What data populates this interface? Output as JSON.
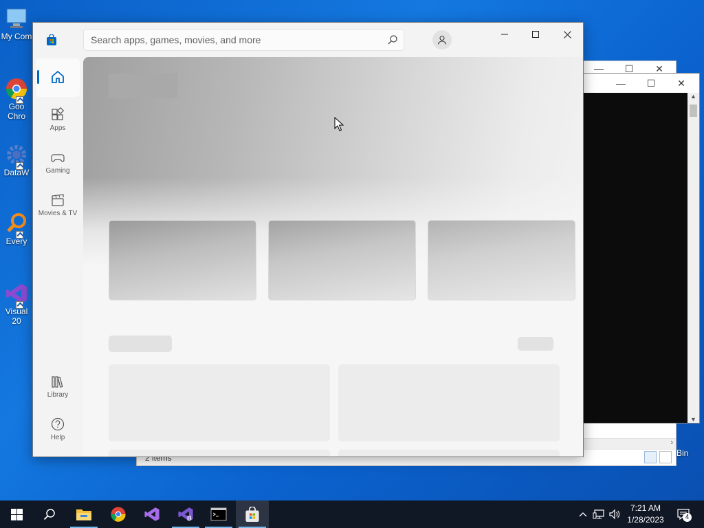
{
  "desktop": {
    "icons": [
      {
        "label": "My Com",
        "name": "computer"
      },
      {
        "label": "Goo Chro",
        "name": "chrome"
      },
      {
        "label": "DataW",
        "name": "datawrangler"
      },
      {
        "label": "Every",
        "name": "everything"
      },
      {
        "label": "Visual 20",
        "name": "visual-studio"
      },
      {
        "label": "Bin",
        "name": "recycle-bin"
      }
    ]
  },
  "explorer": {
    "status_text": "2 items"
  },
  "store": {
    "search_placeholder": "Search apps, games, movies, and more",
    "nav": {
      "home": "",
      "apps": "Apps",
      "gaming": "Gaming",
      "movies": "Movies & TV",
      "library": "Library",
      "help": "Help"
    },
    "colors": {
      "accent": "#0067c0",
      "store_logo": "#0067c0"
    }
  },
  "taskbar": {
    "apps": [
      "start",
      "search",
      "file-explorer",
      "chrome",
      "visual-studio",
      "visual-studio-b",
      "terminal",
      "microsoft-store"
    ],
    "clock_time": "7:21 AM",
    "clock_date": "1/28/2023",
    "notification_count": "4"
  }
}
